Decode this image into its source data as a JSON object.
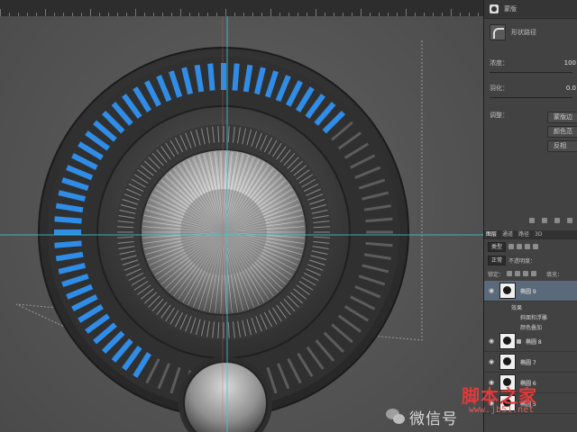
{
  "properties": {
    "header_title": "蒙版",
    "vector_mask_label": "形状路径",
    "density_label": "浓度：",
    "density_value": "100",
    "feather_label": "羽化：",
    "feather_value": "0.0",
    "adjust_label": "调整：",
    "buttons": [
      "蒙版边",
      "颜色范",
      "反相"
    ]
  },
  "layers": {
    "tabs": [
      "图层",
      "通道",
      "路径",
      "3D"
    ],
    "filter_kind": "类型",
    "blend_mode": "正常",
    "opacity_label": "不透明度：",
    "lock_label": "锁定：",
    "fill_label": "填充：",
    "items": [
      {
        "name": "椭圆 9",
        "selected": true
      },
      {
        "name": "椭圆 8",
        "selected": false
      },
      {
        "name": "椭圆 7",
        "selected": false
      },
      {
        "name": "椭圆 6",
        "selected": false
      },
      {
        "name": "椭圆 5",
        "selected": false
      }
    ],
    "effects_label": "效果",
    "effects": [
      "斜面和浮雕",
      "颜色叠加"
    ]
  },
  "watermark": {
    "text": "微信号",
    "site": "脚本之家",
    "url": "www.jb51.net"
  },
  "colors": {
    "accent": "#2f8de8",
    "guide": "#2fd3d3",
    "panel": "#424242"
  }
}
